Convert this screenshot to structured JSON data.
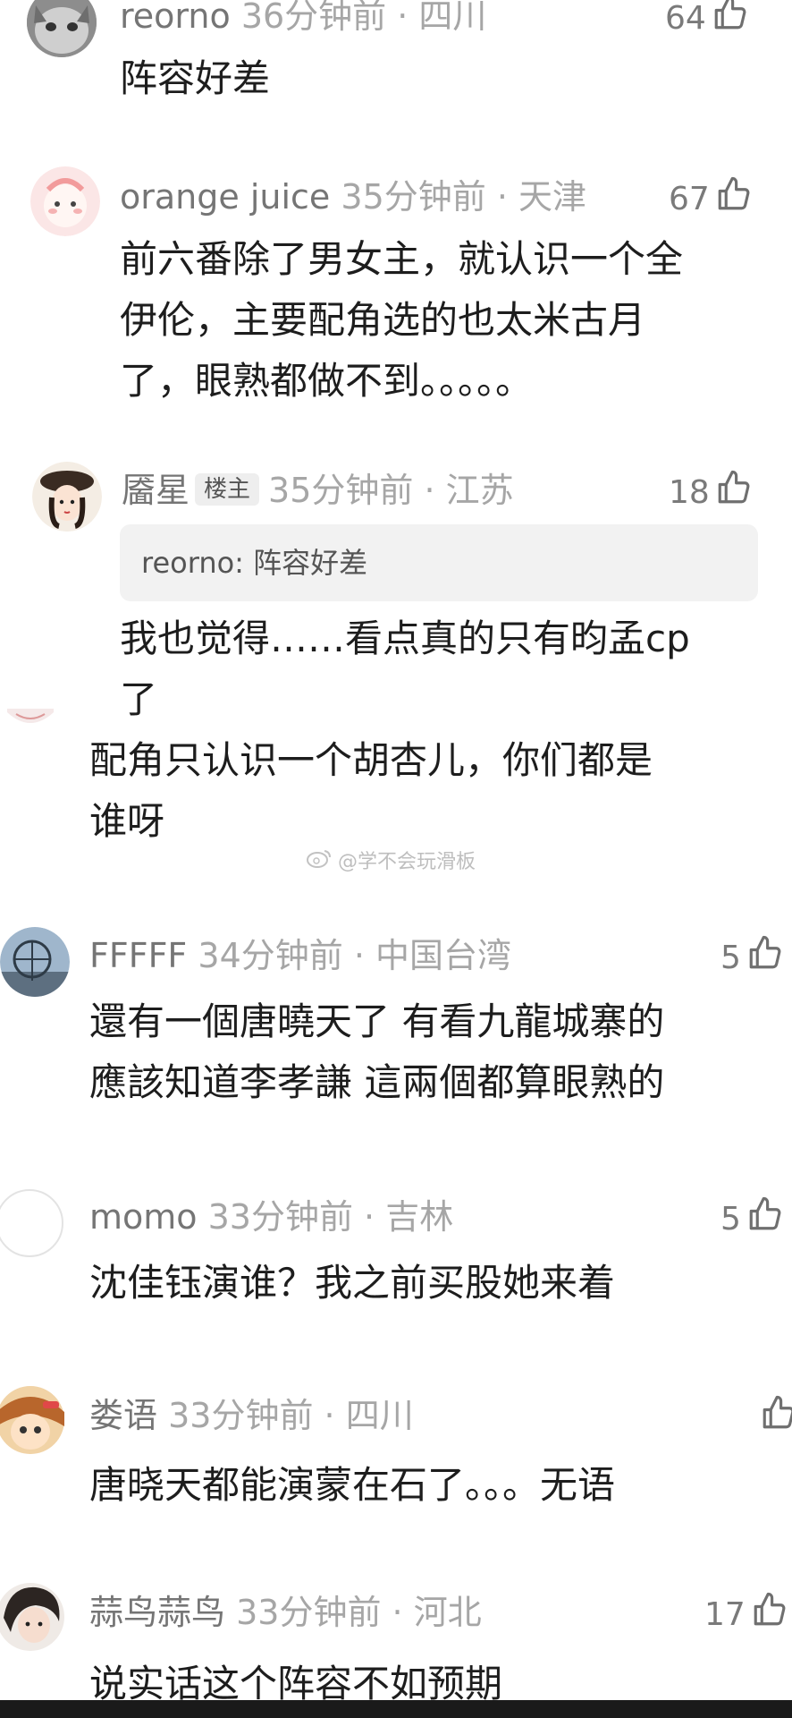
{
  "comments": [
    {
      "username": "reorno",
      "meta": "36分钟前 · 四川",
      "likes": "64",
      "lines": [
        "阵容好差"
      ]
    },
    {
      "username": "orange juice",
      "meta": "35分钟前 · 天津",
      "likes": "67",
      "lines": [
        "前六番除了男女主，就认识一个全",
        "伊伦，主要配角选的也太米古月",
        "了，眼熟都做不到。。。。。"
      ]
    },
    {
      "username": "靥星",
      "badge": "楼主",
      "meta": "35分钟前 · 江苏",
      "likes": "18",
      "quote": "reorno: 阵容好差",
      "lines": [
        "我也觉得……看点真的只有昀孟cp",
        "了"
      ]
    },
    {
      "lines": [
        "配角只认识一个胡杏儿，你们都是",
        "谁呀"
      ]
    },
    {
      "username": "FFFFF",
      "meta": "34分钟前 · 中国台湾",
      "likes": "5",
      "lines": [
        "還有一個唐曉天了 有看九龍城寨的",
        "應該知道李孝謙 這兩個都算眼熟的"
      ]
    },
    {
      "username": "momo",
      "meta": "33分钟前 · 吉林",
      "likes": "5",
      "lines": [
        "沈佳钰演谁？我之前买股她来着"
      ]
    },
    {
      "username": "娄语",
      "meta": "33分钟前 · 四川",
      "likes": "",
      "lines": [
        "唐晓天都能演蒙在石了。。。无语"
      ]
    },
    {
      "username": "蒜鸟蒜鸟",
      "meta": "33分钟前 · 河北",
      "likes": "17",
      "lines": [
        "说实话这个阵容不如预期"
      ]
    }
  ],
  "watermark": "@学不会玩滑板",
  "icons": {
    "like": "thumbs-up-icon",
    "watermark": "weibo-logo-icon"
  }
}
